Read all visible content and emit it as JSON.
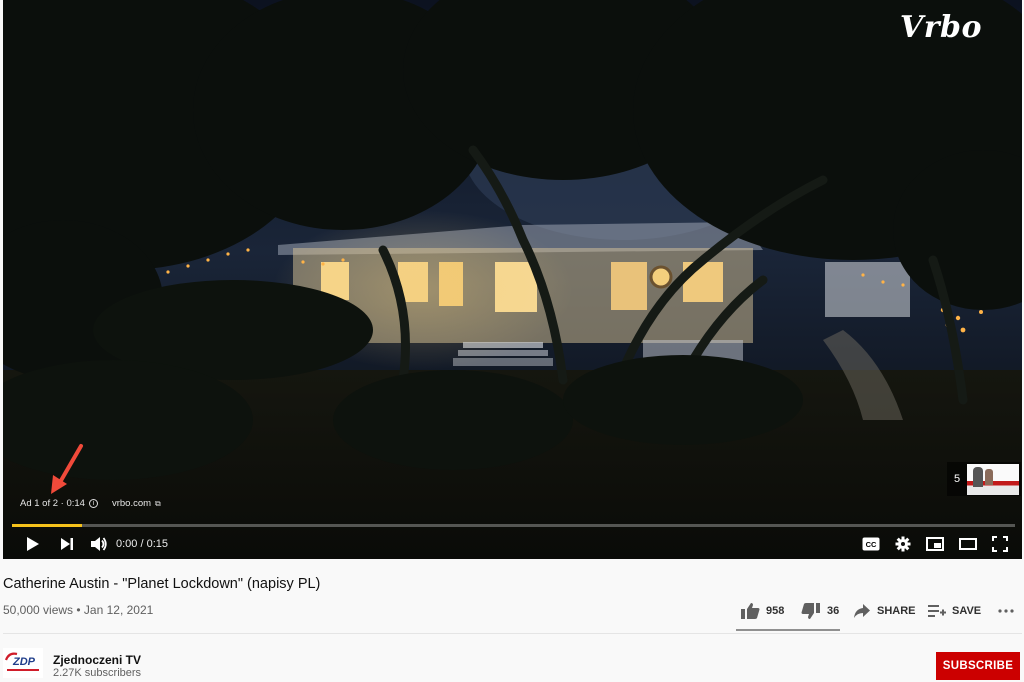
{
  "player": {
    "brand_logo": "Vrbo",
    "ad_counter": "Ad 1 of 2 · 0:14",
    "ad_site": "vrbo.com",
    "up_next_count": "5",
    "ad_progress": 0.07,
    "time_display": "0:00 / 0:15",
    "icons": {
      "play": "play-icon",
      "next": "skip-next-icon",
      "volume": "volume-icon",
      "captions": "captions-icon",
      "settings": "gear-icon",
      "miniplayer": "miniplayer-icon",
      "theater": "theater-mode-icon",
      "fullscreen": "fullscreen-icon"
    },
    "colors": {
      "progress": "#f6c21b",
      "annotation_arrow": "#f04a3a"
    }
  },
  "video": {
    "title": "Catherine Austin - \"Planet Lockdown\" (napisy PL)",
    "meta": "50,000 views • Jan 12, 2021",
    "likes": "958",
    "dislikes": "36",
    "share_label": "SHARE",
    "save_label": "SAVE",
    "more_icon": "more-horizontal-icon"
  },
  "channel": {
    "name": "Zjednoczeni TV",
    "subscribers": "2.27K subscribers",
    "logo_text": "ZDP",
    "subscribe_label": "SUBSCRIBE",
    "subscribe_color": "#cc0000"
  }
}
